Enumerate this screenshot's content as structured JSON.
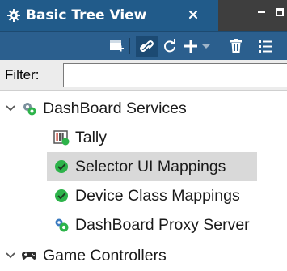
{
  "tab": {
    "title": "Basic Tree View",
    "icon": "gear-icon"
  },
  "toolbar": {
    "icons": [
      "new-window-icon",
      "link-icon",
      "refresh-icon",
      "add-icon",
      "dropdown-arrow-icon",
      "delete-icon",
      "list-icon"
    ]
  },
  "filter": {
    "label": "Filter:",
    "value": "",
    "placeholder": ""
  },
  "tree": {
    "items": [
      {
        "label": "DashBoard Services",
        "expanded": true,
        "level": 0,
        "icon": "services-gear-icon",
        "selected": false
      },
      {
        "label": "Tally",
        "level": 1,
        "icon": "tally-icon",
        "selected": false
      },
      {
        "label": "Selector UI Mappings",
        "level": 1,
        "icon": "green-check-icon",
        "selected": true
      },
      {
        "label": "Device Class Mappings",
        "level": 1,
        "icon": "green-check-icon",
        "selected": false
      },
      {
        "label": "DashBoard Proxy Server",
        "level": 1,
        "icon": "proxy-server-icon",
        "selected": false
      },
      {
        "label": "Game Controllers",
        "expanded": true,
        "level": 0,
        "icon": "gamepad-icon",
        "selected": false
      }
    ]
  },
  "colors": {
    "tab_active": "#215b8a",
    "toolbar": "#2b5f8e",
    "selection": "#d9d9d9",
    "check_green": "#2db34a"
  }
}
